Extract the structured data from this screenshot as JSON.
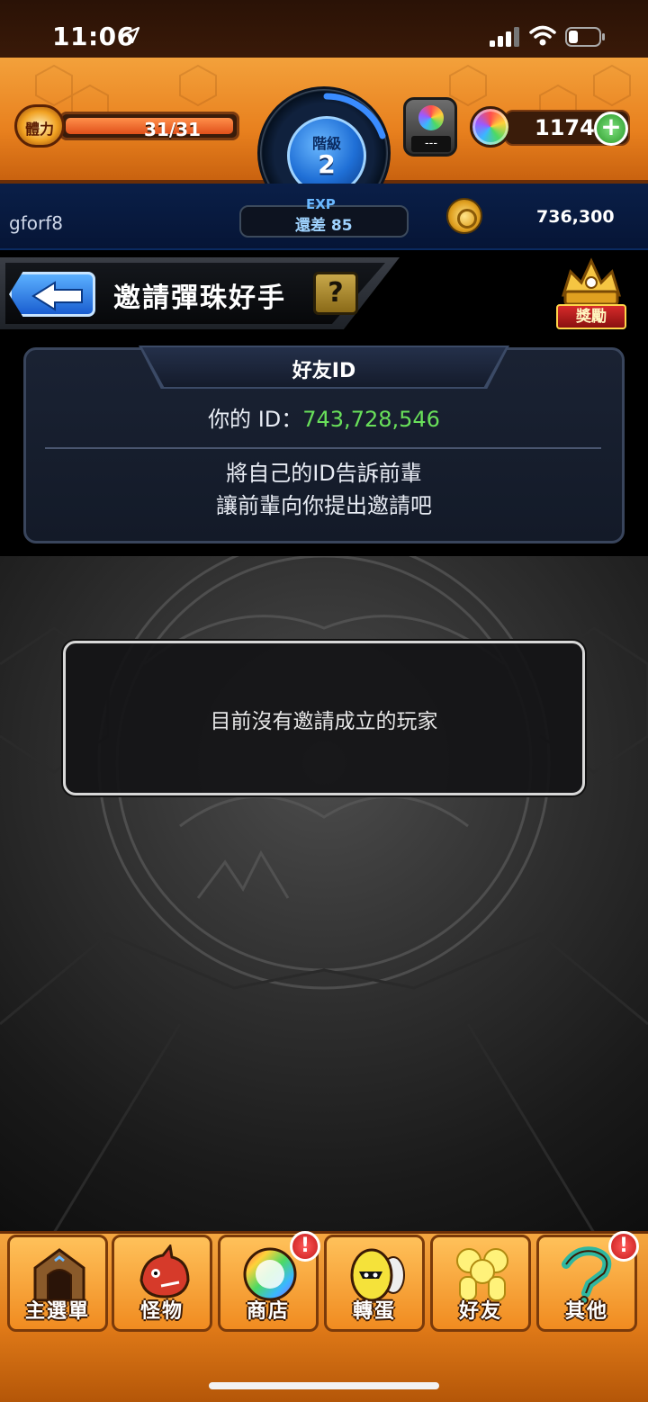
{
  "status_bar": {
    "time": "11:06"
  },
  "header": {
    "stamina_label": "體力",
    "stamina": "31/31",
    "stamina_fraction": 1.0,
    "rank_label": "階級",
    "rank": "2",
    "gem_slot_text": "---",
    "orbs": "1174",
    "orb_add_label": "+"
  },
  "info_strip": {
    "username": "gforf8",
    "exp_label": "EXP",
    "exp_remaining": "還差 85",
    "gold": "736,300"
  },
  "title_bar": {
    "title": "邀請彈珠好手",
    "help_label": "?",
    "reward_label": "獎勵"
  },
  "friend_id_panel": {
    "header": "好友ID",
    "id_label": "你的 ID：",
    "id_value": "743,728,546",
    "desc_line1": "將自己的ID告訴前輩",
    "desc_line2": "讓前輩向你提出邀請吧"
  },
  "invite_list": {
    "empty_message": "目前沒有邀請成立的玩家"
  },
  "bottom_nav": {
    "items": [
      {
        "label": "主選單",
        "icon": "gate-icon",
        "alert": false
      },
      {
        "label": "怪物",
        "icon": "dragon-icon",
        "alert": false
      },
      {
        "label": "商店",
        "icon": "orb-icon",
        "alert": true
      },
      {
        "label": "轉蛋",
        "icon": "egg-icon",
        "alert": false
      },
      {
        "label": "好友",
        "icon": "friends-icon",
        "alert": false
      },
      {
        "label": "其他",
        "icon": "question-icon",
        "alert": true
      }
    ],
    "alert_glyph": "!"
  },
  "colors": {
    "accent_orange": "#e8801e",
    "id_value_green": "#69e05a",
    "rank_blue": "#1f6fd6"
  }
}
